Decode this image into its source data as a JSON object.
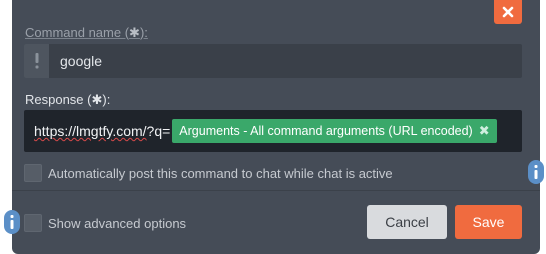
{
  "dialog": {
    "command_name_label": "Command name (",
    "command_name_label_end": "):",
    "command_name_required": "✱",
    "command_name_value": "google",
    "response_label": "Response (",
    "response_label_end": "):",
    "response_required": "✱",
    "response_url": "https://lmgtfy.com/",
    "response_url_suffix": "?q=",
    "response_tag": "Arguments - All command arguments (URL encoded)",
    "response_tag_remove": "✖",
    "auto_post_label": "Automatically post this command to chat while chat is active",
    "advanced_label": "Show advanced options",
    "cancel_label": "Cancel",
    "save_label": "Save"
  },
  "colors": {
    "dialog_bg": "#454c57",
    "accent": "#f06b3f",
    "tag_green": "#3aa86a",
    "info_blue": "#5b8fc7"
  },
  "icons": [
    "close-icon",
    "exclamation-icon",
    "info-icon"
  ]
}
